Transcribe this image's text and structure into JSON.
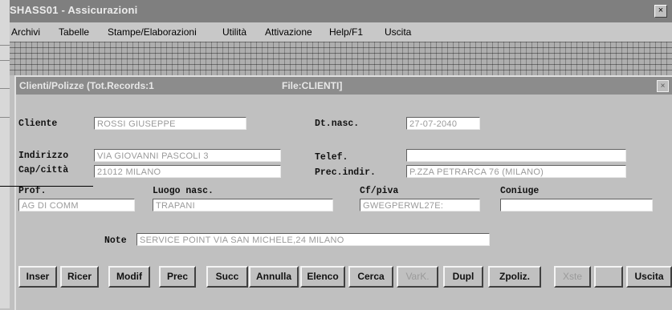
{
  "window": {
    "title": "SHASS01 - Assicurazioni",
    "close": "×"
  },
  "menu": [
    {
      "label": "Archivi"
    },
    {
      "label": "Tabelle"
    },
    {
      "label": "Stampe/Elaborazioni"
    },
    {
      "label": "Utilità"
    },
    {
      "label": "Attivazione"
    },
    {
      "label": "Help/F1"
    },
    {
      "label": "Uscita"
    }
  ],
  "form": {
    "title_left": "Clienti/Polizze (Tot.Records:1",
    "title_right": "File:CLIENTI]",
    "close": "×",
    "fields": {
      "cliente": {
        "label": "Cliente",
        "value": "ROSSI GIUSEPPE"
      },
      "dt_nasc": {
        "label": "Dt.nasc.",
        "value": "27-07-2040"
      },
      "indirizzo": {
        "label": "Indirizzo",
        "value": "VIA GIOVANNI PASCOLI 3"
      },
      "telef": {
        "label": "Telef.",
        "value": ""
      },
      "cap_citta": {
        "label": "Cap/città",
        "value": "21012 MILANO"
      },
      "prec_indir": {
        "label": "Prec.indir.",
        "value": "P.ZZA PETRARCA 76     (MILANO)"
      },
      "prof": {
        "label": "Prof.",
        "value": "AG DI COMM"
      },
      "luogo_nasc": {
        "label": "Luogo nasc.",
        "value": "TRAPANI"
      },
      "cf_piva": {
        "label": "Cf/piva",
        "value": "GWEGPERWL27E:"
      },
      "coniuge": {
        "label": "Coniuge",
        "value": ""
      },
      "note": {
        "label": "Note",
        "value": "SERVICE POINT VIA SAN MICHELE,24 MILANO"
      }
    },
    "buttons": [
      {
        "label": "Inser",
        "enabled": true
      },
      {
        "label": "Ricer",
        "enabled": true
      },
      {
        "label": "Modif",
        "enabled": true
      },
      {
        "label": "Prec",
        "enabled": true
      },
      {
        "label": "Succ",
        "enabled": true
      },
      {
        "label": "Annulla",
        "enabled": true
      },
      {
        "label": "Elenco",
        "enabled": true
      },
      {
        "label": "Cerca",
        "enabled": true
      },
      {
        "label": "VarK.",
        "enabled": false
      },
      {
        "label": "Dupl",
        "enabled": true
      },
      {
        "label": "Zpoliz.",
        "enabled": true
      },
      {
        "label": "Xste",
        "enabled": false
      },
      {
        "label": "",
        "enabled": true
      },
      {
        "label": "Uscita",
        "enabled": true
      }
    ]
  },
  "colors": {
    "titlebar": "#7f7f7f",
    "child_titlebar": "#8c8c8c",
    "face": "#c0c0c0",
    "field_text": "#9a9a9a"
  }
}
